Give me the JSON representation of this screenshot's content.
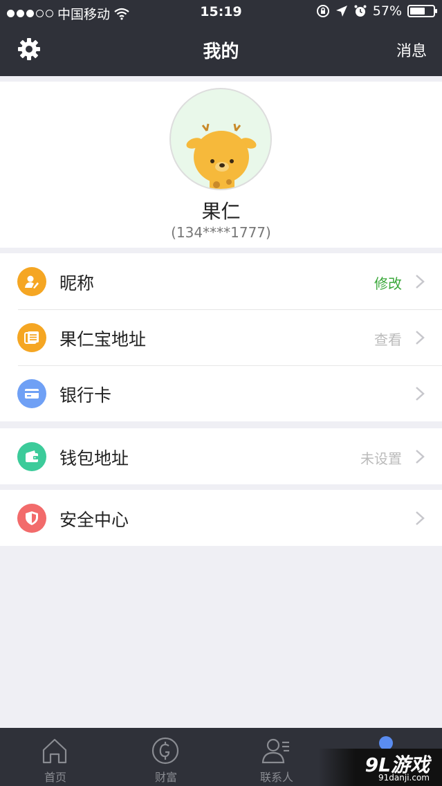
{
  "status_bar": {
    "carrier": "中国移动",
    "time": "15:19",
    "battery": "57%"
  },
  "nav": {
    "title": "我的",
    "right_label": "消息",
    "left_icon": "gear-icon"
  },
  "profile": {
    "name": "果仁",
    "phone": "(134****1777)",
    "avatar": "deer-avatar"
  },
  "groups": [
    {
      "rows": [
        {
          "label": "昵称",
          "value": "修改",
          "value_color": "#3aa83a",
          "icon": "pencil-user-icon",
          "icon_color": "#f5a623"
        },
        {
          "label": "果仁宝地址",
          "value": "查看",
          "icon": "document-stack-icon",
          "icon_color": "#f5a623"
        },
        {
          "label": "银行卡",
          "value": "",
          "icon": "bank-card-icon",
          "icon_color": "#6fa0f5"
        }
      ]
    },
    {
      "rows": [
        {
          "label": "钱包地址",
          "value": "未设置",
          "icon": "wallet-icon",
          "icon_color": "#3ccb9a"
        }
      ]
    },
    {
      "rows": [
        {
          "label": "安全中心",
          "value": "",
          "icon": "shield-icon",
          "icon_color": "#f26b6b"
        }
      ]
    }
  ],
  "tabbar": {
    "tabs": [
      {
        "label": "首页",
        "icon": "home-icon"
      },
      {
        "label": "财富",
        "icon": "coin-icon"
      },
      {
        "label": "联系人",
        "icon": "contacts-icon"
      },
      {
        "label": "",
        "icon": "profile-icon"
      }
    ],
    "active_color": "#5a8cf0"
  },
  "watermark": {
    "logo": "9L游戏",
    "site": "91danji.com"
  }
}
